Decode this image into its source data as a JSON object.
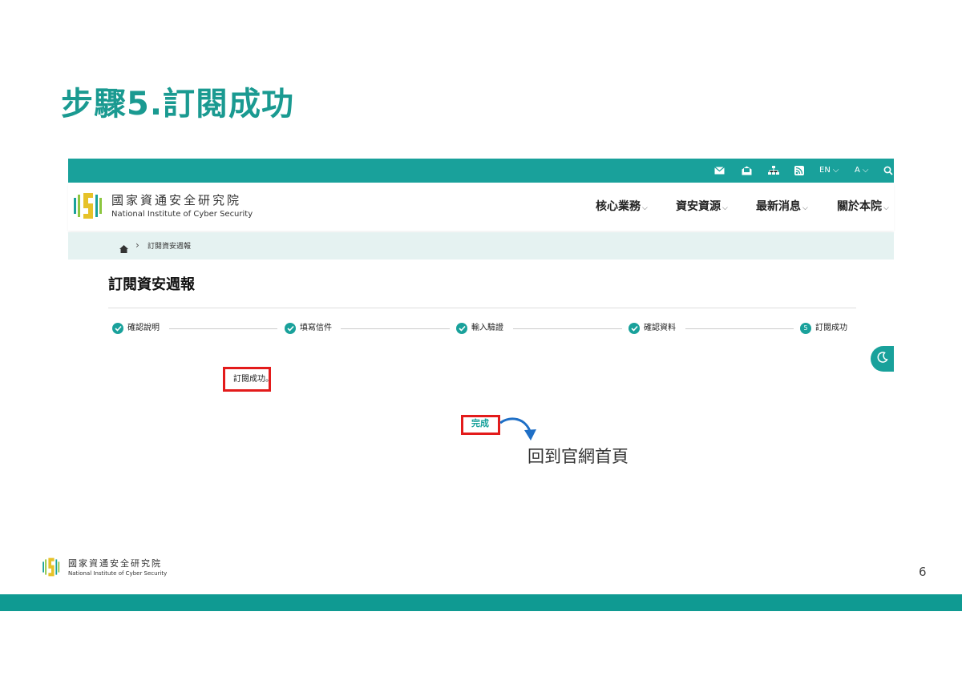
{
  "slide": {
    "title": "步驟5.訂閱成功",
    "page_number": "6",
    "annotation": "回到官網首頁"
  },
  "topbar": {
    "icons": [
      "mail-icon",
      "open-mail-icon",
      "sitemap-icon",
      "rss-icon"
    ],
    "lang_label": "EN",
    "font_label": "A"
  },
  "header": {
    "org_name_cn": "國家資通安全研究院",
    "org_name_en": "National Institute of Cyber Security",
    "nav": [
      "核心業務",
      "資安資源",
      "最新消息",
      "關於本院"
    ]
  },
  "breadcrumb": {
    "current": "訂閱資安週報"
  },
  "page": {
    "heading": "訂閱資安週報",
    "steps": [
      {
        "label": "確認說明",
        "status": "done"
      },
      {
        "label": "填寫信件",
        "status": "done"
      },
      {
        "label": "輸入驗證",
        "status": "done"
      },
      {
        "label": "確認資料",
        "status": "done"
      },
      {
        "label": "訂閱成功",
        "status": "current",
        "number": "5"
      }
    ],
    "success_message": "訂閱成功。",
    "done_button": "完成"
  },
  "footer": {
    "org_name_cn": "國家資通安全研究院",
    "org_name_en": "National Institute of Cyber Security"
  },
  "colors": {
    "accent": "#19a19b",
    "title": "#1a9a91",
    "highlight": "#e31b1b",
    "arrow": "#1f6fc6"
  }
}
